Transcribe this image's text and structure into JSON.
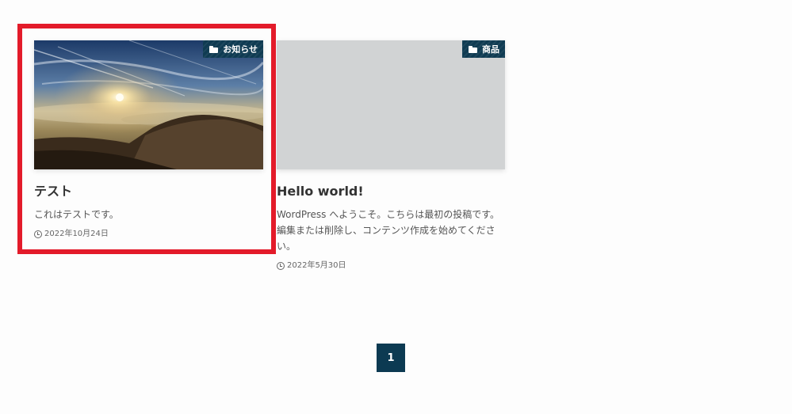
{
  "posts": [
    {
      "category": "お知らせ",
      "title": "テスト",
      "excerpt": "これはテストです。",
      "date": "2022年10月24日"
    },
    {
      "category": "商品",
      "title": "Hello world!",
      "excerpt": "WordPress へようこそ。こちらは最初の投稿です。編集または削除し、コンテンツ作成を始めてください。",
      "date": "2022年5月30日"
    }
  ],
  "pagination": {
    "current": "1"
  },
  "colors": {
    "accent": "#0f3b52",
    "highlight": "#e31b2a",
    "placeholder": "#d1d3d4"
  },
  "icons": {
    "category": "folder-icon",
    "date": "clock-icon"
  }
}
